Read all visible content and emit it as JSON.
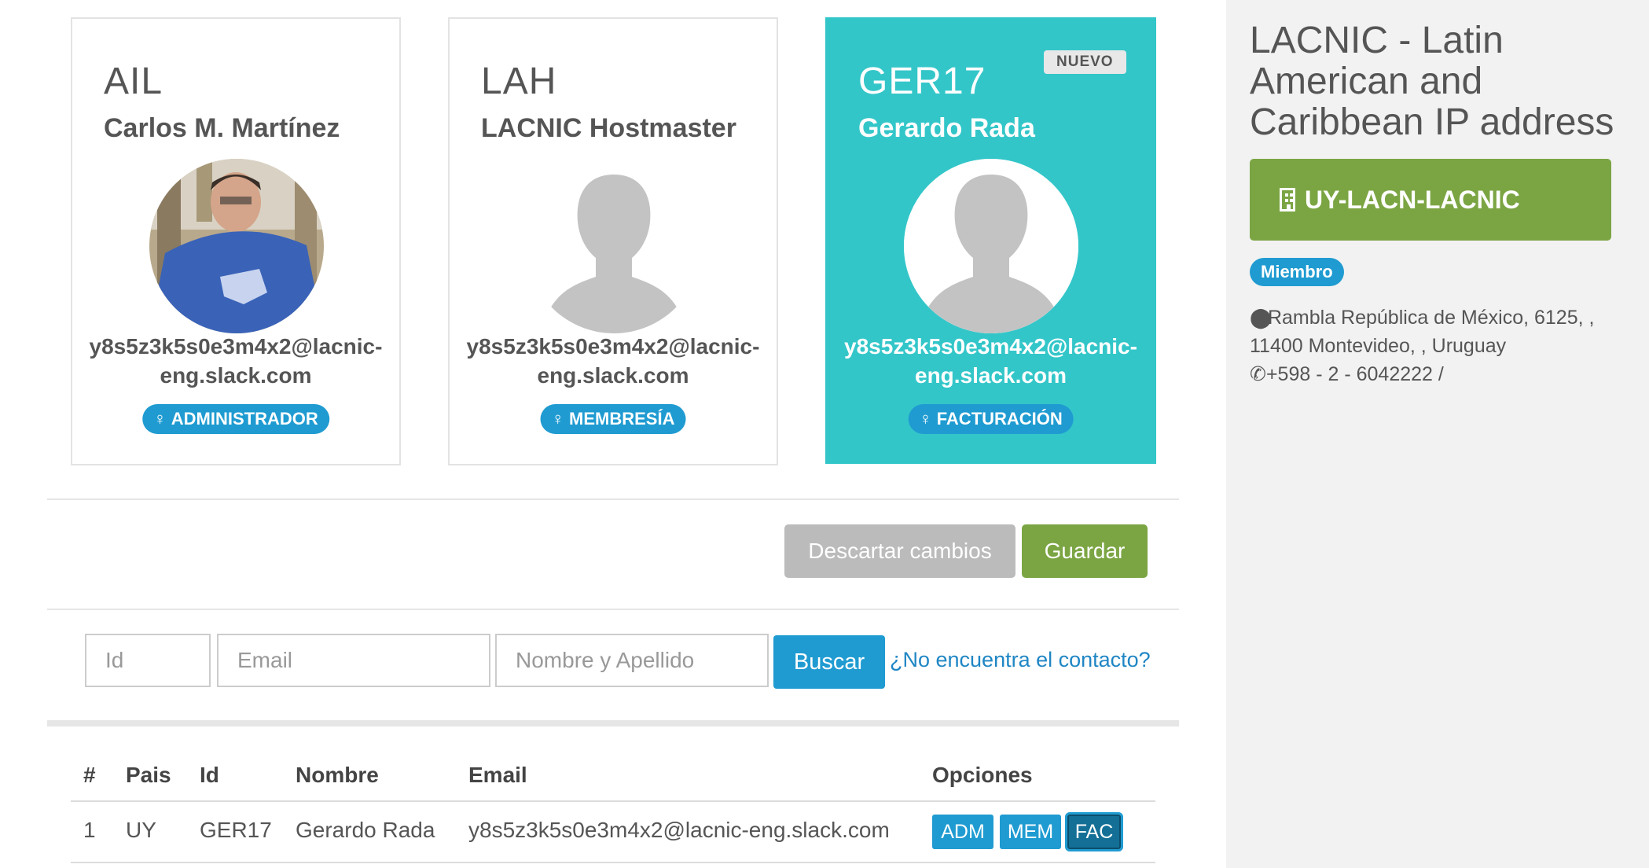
{
  "contacts": [
    {
      "handle": "AIL",
      "name": "Carlos M. Martínez",
      "email": "y8s5z3k5s0e3m4x2@lacnic-eng.slack.com",
      "role": "ADMINISTRADOR",
      "avatar": "photo-avatar"
    },
    {
      "handle": "LAH",
      "name": "LACNIC Hostmaster",
      "email": "y8s5z3k5s0e3m4x2@lacnic-eng.slack.com",
      "role": "MEMBRESÍA",
      "avatar": "default-avatar"
    },
    {
      "handle": "GER17",
      "name": "Gerardo Rada",
      "email": "y8s5z3k5s0e3m4x2@lacnic-eng.slack.com",
      "role": "FACTURACIÓN",
      "badge": "NUEVO",
      "avatar": "default-avatar"
    }
  ],
  "actions": {
    "discard_label": "Descartar cambios",
    "save_label": "Guardar"
  },
  "search": {
    "id_placeholder": "Id",
    "email_placeholder": "Email",
    "name_placeholder": "Nombre y Apellido",
    "button_label": "Buscar",
    "not_found_link": "¿No encuentra el contacto?"
  },
  "table": {
    "headers": [
      "#",
      "Pais",
      "Id",
      "Nombre",
      "Email",
      "Opciones"
    ],
    "rows": [
      {
        "num": "1",
        "pais": "UY",
        "id": "GER17",
        "nombre": "Gerardo Rada",
        "email": "y8s5z3k5s0e3m4x2@lacnic-eng.slack.com",
        "options": [
          "ADM",
          "MEM",
          "FAC"
        ],
        "active_option": "FAC"
      }
    ]
  },
  "organization": {
    "title": "LACNIC - Latin American and Caribbean IP address",
    "code": "UY-LACN-LACNIC",
    "status": "Miembro",
    "address": "Rambla República de México, 6125, , 11400 Montevideo, , Uruguay",
    "phone": "+598 - 2 - 6042222 /"
  },
  "colors": {
    "accent_blue": "#1f9bd1",
    "green": "#7ba543",
    "teal_card": "#33c6c9",
    "gray_button": "#bbbbbb"
  }
}
